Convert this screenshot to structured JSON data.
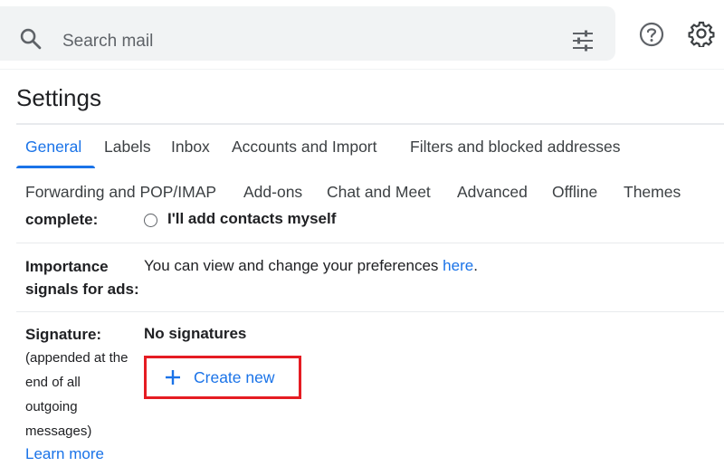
{
  "search": {
    "placeholder": "Search mail"
  },
  "header": {
    "title": "Settings"
  },
  "tabs": [
    {
      "label": "General",
      "active": true
    },
    {
      "label": "Labels"
    },
    {
      "label": "Inbox"
    },
    {
      "label": "Accounts and Import"
    },
    {
      "label": "Filters and blocked addresses"
    },
    {
      "label": "Forwarding and POP/IMAP"
    },
    {
      "label": "Add-ons"
    },
    {
      "label": "Chat and Meet"
    },
    {
      "label": "Advanced"
    },
    {
      "label": "Offline"
    },
    {
      "label": "Themes"
    }
  ],
  "settings": {
    "autocomplete": {
      "label": "complete:",
      "option": "I'll add contacts myself"
    },
    "importance": {
      "label_line1": "Importance",
      "label_line2": "signals for ads:",
      "text": "You can view and change your preferences ",
      "link": "here",
      "suffix": "."
    },
    "signature": {
      "label": "Signature:",
      "desc_lines": [
        "(appended at the",
        "end of all",
        "outgoing",
        "messages)"
      ],
      "learn_more": "Learn more",
      "status": "No signatures",
      "create_button": "Create new"
    }
  },
  "colors": {
    "accent": "#1a73e8",
    "highlight": "#e51c23"
  }
}
